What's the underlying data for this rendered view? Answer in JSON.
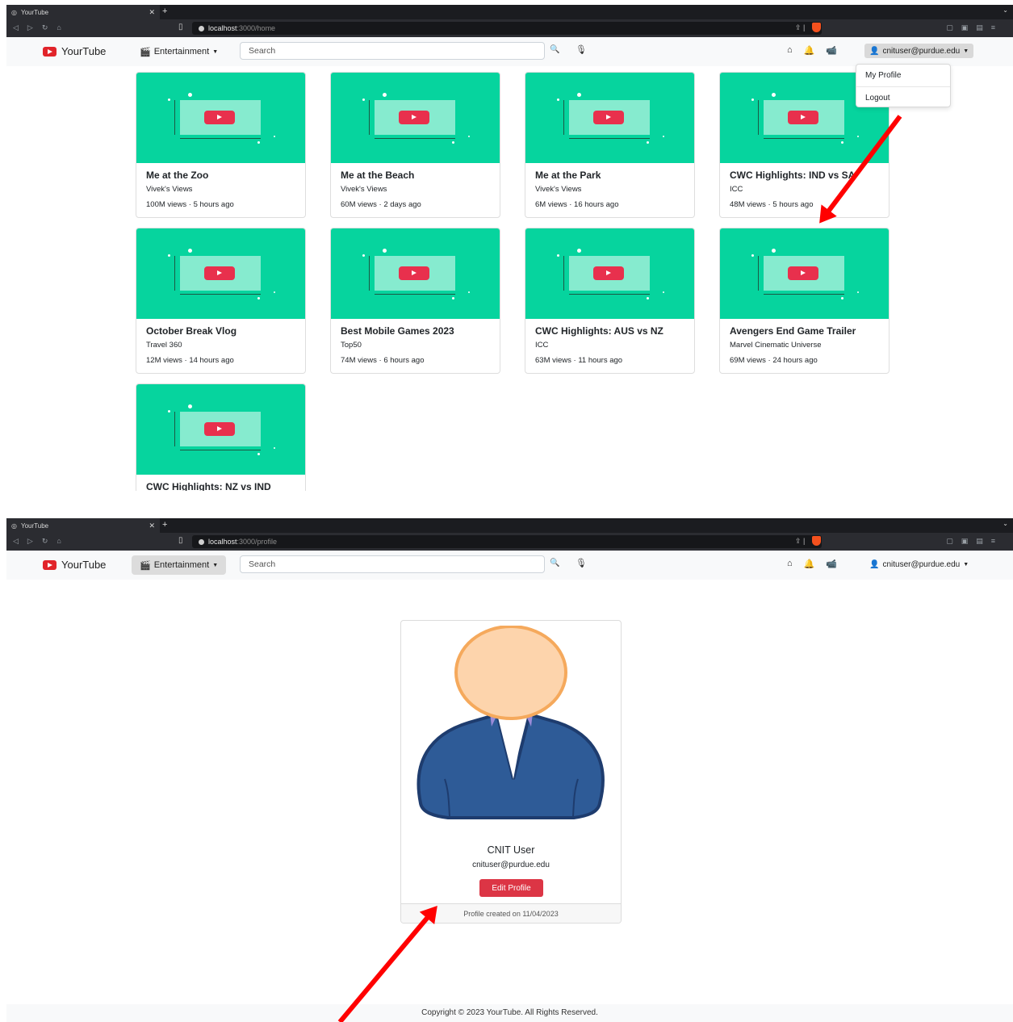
{
  "browser": {
    "tab_title": "YourTube",
    "new_tab": "+",
    "home_url_host": "localhost",
    "home_url_path": ":3000/home",
    "profile_url_host": "localhost",
    "profile_url_path": ":3000/profile"
  },
  "navbar": {
    "logo_text": "YourTube",
    "category_label": "Entertainment",
    "search_placeholder": "Search",
    "user_email": "cnituser@purdue.edu"
  },
  "dropdown": {
    "items": [
      "My Profile",
      "Logout"
    ]
  },
  "videos": [
    {
      "title": "Me at the Zoo",
      "channel": "Vivek's Views",
      "meta": "100M views · 5 hours ago"
    },
    {
      "title": "Me at the Beach",
      "channel": "Vivek's Views",
      "meta": "60M views · 2 days ago"
    },
    {
      "title": "Me at the Park",
      "channel": "Vivek's Views",
      "meta": "6M views · 16 hours ago"
    },
    {
      "title": "CWC Highlights: IND vs SA",
      "channel": "ICC",
      "meta": "48M views · 5 hours ago"
    },
    {
      "title": "October Break Vlog",
      "channel": "Travel 360",
      "meta": "12M views · 14 hours ago"
    },
    {
      "title": "Best Mobile Games 2023",
      "channel": "Top50",
      "meta": "74M views · 6 hours ago"
    },
    {
      "title": "CWC Highlights: AUS vs NZ",
      "channel": "ICC",
      "meta": "63M views · 11 hours ago"
    },
    {
      "title": "Avengers End Game Trailer",
      "channel": "Marvel Cinematic Universe",
      "meta": "69M views · 24 hours ago"
    },
    {
      "title": "CWC Highlights: NZ vs IND",
      "channel": "",
      "meta": ""
    }
  ],
  "profile": {
    "name": "CNIT User",
    "email": "cnituser@purdue.edu",
    "edit_label": "Edit Profile",
    "created": "Profile created on 11/04/2023"
  },
  "footer": {
    "copyright": "Copyright © 2023 YourTube. All Rights Reserved."
  },
  "colors": {
    "thumbnail_bg": "#06d49e",
    "play_button": "#e8304d",
    "edit_button": "#dc3545",
    "annotation_arrow": "#ff0000"
  },
  "icons": [
    "globe-icon",
    "back-icon",
    "forward-icon",
    "reload-icon",
    "home-icon",
    "bookmark-icon",
    "share-icon",
    "brave-shield-icon",
    "film-icon",
    "search-icon",
    "mic-icon",
    "bell-icon",
    "video-camera-icon",
    "user-icon",
    "chevron-down-icon"
  ]
}
